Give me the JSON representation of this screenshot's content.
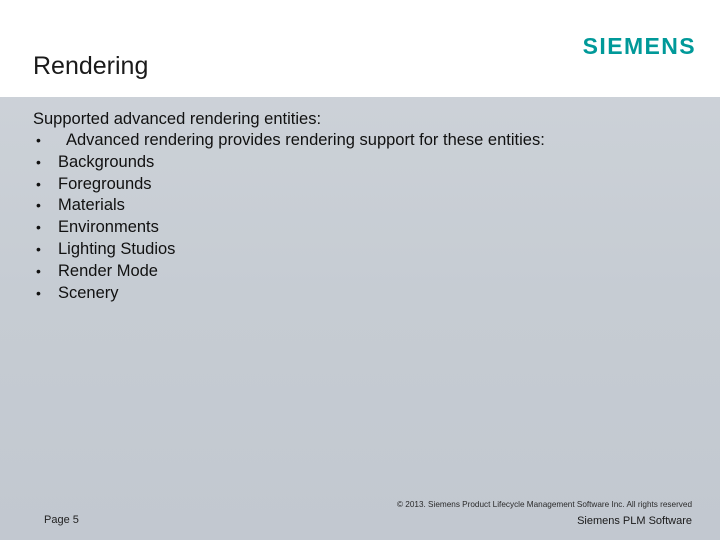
{
  "header": {
    "title": "Rendering",
    "logo_text": "SIEMENS",
    "logo_color": "#009999"
  },
  "content": {
    "lead": "Supported advanced rendering entities:",
    "bullets": [
      "Advanced rendering provides rendering support for these entities:",
      "Backgrounds",
      "Foregrounds",
      "Materials",
      "Environments",
      "Lighting Studios",
      "Render Mode",
      "Scenery"
    ],
    "bullet_glyph": "•"
  },
  "footer": {
    "page_label": "Page 5",
    "copyright": "© 2013.  Siemens Product Lifecycle Management Software Inc. All rights reserved",
    "brand": "Siemens PLM Software"
  }
}
